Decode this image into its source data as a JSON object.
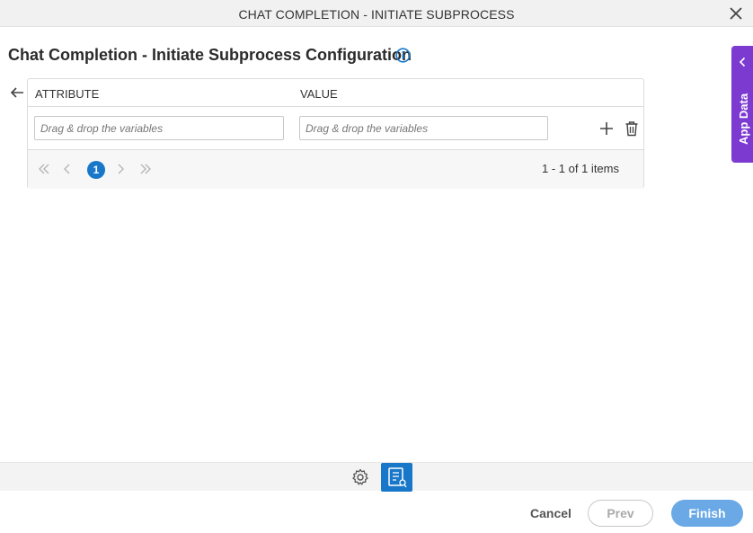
{
  "window": {
    "title": "CHAT COMPLETION - INITIATE SUBPROCESS",
    "close_icon": "close-icon"
  },
  "main": {
    "heading": "Chat Completion - Initiate Subprocess Configuration",
    "info_icon": "info-icon",
    "back_icon": "arrow-left-icon"
  },
  "grid": {
    "columns": [
      "ATTRIBUTE",
      "VALUE"
    ],
    "rows": [
      {
        "attribute_placeholder": "Drag & drop the variables",
        "value_placeholder": "Drag & drop the variables"
      }
    ],
    "pager": {
      "current_page": "1",
      "items_text": "1 - 1 of 1 items"
    }
  },
  "side_panel": {
    "label": "App Data"
  },
  "toolbar": {
    "gear_icon": "gear-icon",
    "doc_icon": "document-icon"
  },
  "footer": {
    "cancel": "Cancel",
    "prev": "Prev",
    "finish": "Finish"
  },
  "colors": {
    "accent_blue": "#1877c9",
    "finish_blue": "#6aa9e6",
    "app_data_purple": "#7c3ad1"
  }
}
